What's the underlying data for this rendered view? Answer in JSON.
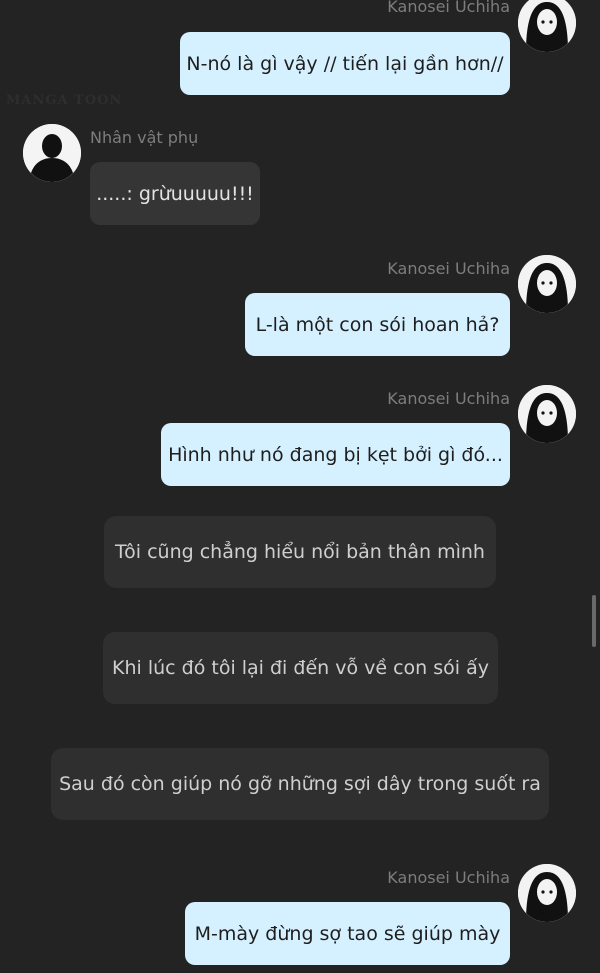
{
  "watermark": "MANGA TOON",
  "messages": [
    {
      "speaker": "Kanosei Uchiha",
      "text": "N-nó là gì vậy // tiến lại gần hơn//"
    },
    {
      "speaker": "Nhân vật phụ",
      "text": ".....: grừuuuuu!!!"
    },
    {
      "speaker": "Kanosei Uchiha",
      "text": "L-là một con sói hoan hả?"
    },
    {
      "speaker": "Kanosei Uchiha",
      "text": "Hình như nó đang bị kẹt bởi gì đó..."
    },
    {
      "text": "Tôi cũng chẳng hiểu nổi bản thân mình"
    },
    {
      "text": "Khi lúc đó tôi lại đi đến vỗ về con sói ấy"
    },
    {
      "text": "Sau đó còn giúp nó gỡ những sợi dây trong suốt ra"
    },
    {
      "speaker": "Kanosei Uchiha",
      "text": "M-mày đừng sợ tao sẽ giúp mày"
    }
  ]
}
